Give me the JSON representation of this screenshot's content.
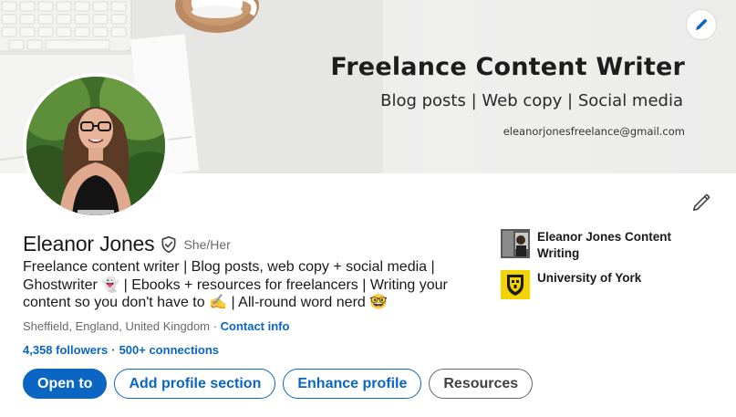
{
  "banner": {
    "title": "Freelance Content Writer",
    "subtitle": "Blog posts | Web copy | Social media",
    "email": "eleanorjonesfreelance@gmail.com"
  },
  "profile": {
    "name": "Eleanor Jones",
    "pronouns": "She/Her",
    "headline": "Freelance content writer | Blog posts, web copy + social media | Ghostwriter 👻 | Ebooks + resources for freelancers | Writing your content so you don't have to ✍️ | All-round word nerd 🤓",
    "location": "Sheffield, England, United Kingdom",
    "location_separator": "·",
    "contact_info": "Contact info",
    "followers": "4,358 followers",
    "network_separator": "·",
    "connections": "500+ connections"
  },
  "actions": {
    "open_to": "Open to",
    "add_section": "Add profile section",
    "enhance": "Enhance profile",
    "resources": "Resources"
  },
  "orgs": [
    {
      "name": "Eleanor Jones Content Writing"
    },
    {
      "name": "University of York"
    }
  ],
  "colors": {
    "accent": "#0a66c2",
    "york_yellow": "#f4d400"
  },
  "icons": {
    "banner_edit": "pencil-icon",
    "profile_edit": "pencil-icon",
    "verified": "shield-check-icon"
  }
}
